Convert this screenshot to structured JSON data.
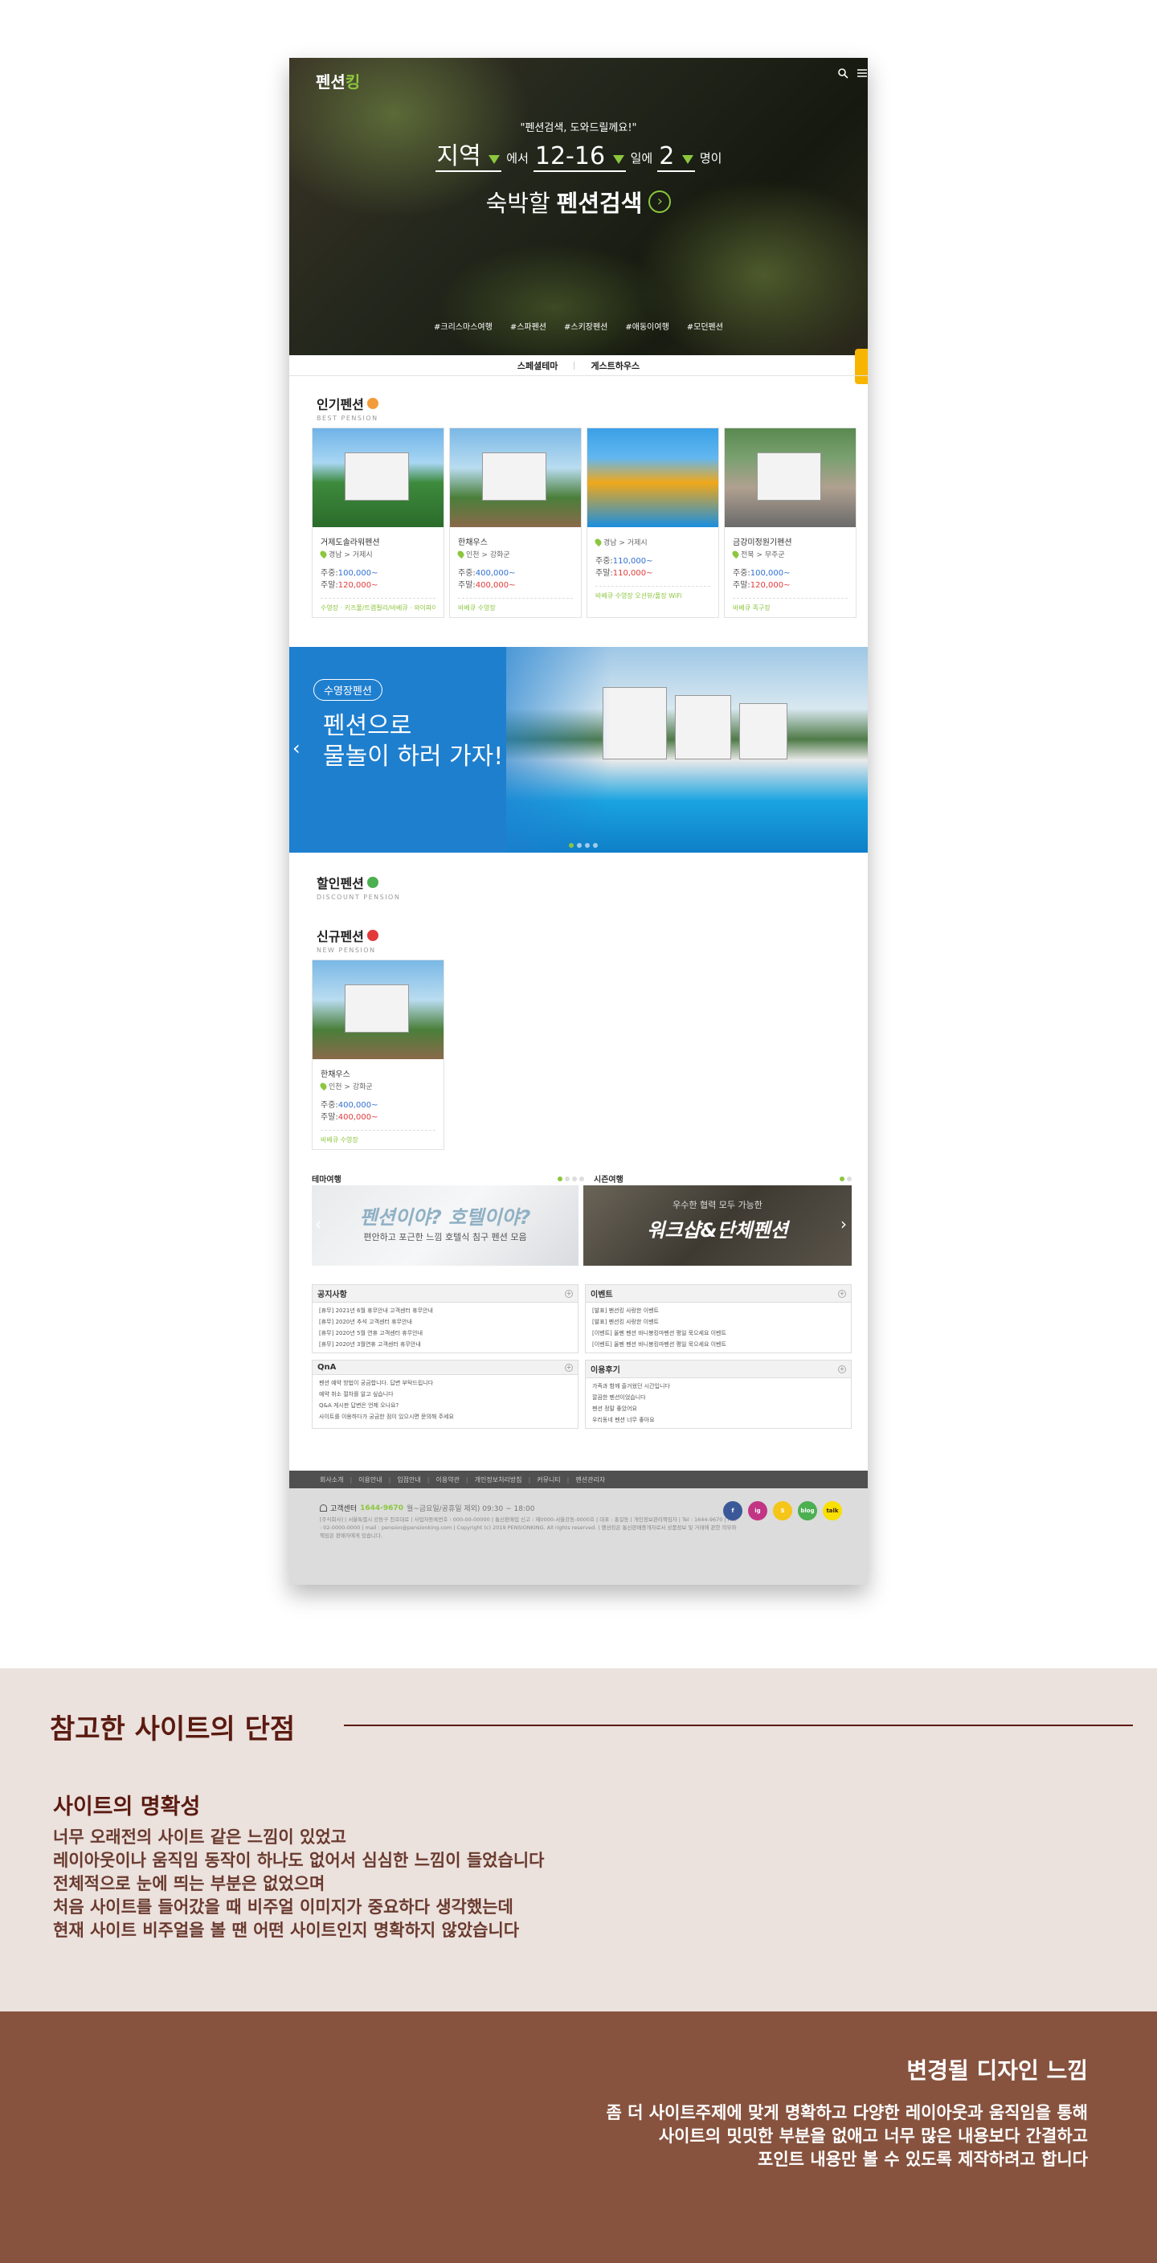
{
  "site": {
    "logo_text": "펜션",
    "logo_accent": "킹",
    "icons": [
      "search-icon",
      "menu-icon"
    ]
  },
  "hero": {
    "tagline": "\"펜션검색, 도와드릴께요!\"",
    "region": "지역",
    "region_suffix": "에서",
    "dates": "12-16",
    "dates_suffix": "일에",
    "count": "2",
    "count_suffix": "명이",
    "line2_pre": "숙박할",
    "line2_bold": "펜션검색",
    "tags": [
      "#크리스마스여행",
      "#스파펜션",
      "#스키장펜션",
      "#애동이여행",
      "#모던펜션"
    ]
  },
  "subnav": [
    "스페셜테마",
    "게스트하우스"
  ],
  "best": {
    "title": "인기펜션",
    "subtitle": "BEST PENSION",
    "items": [
      {
        "name": "거제도솔라워펜션",
        "loc": "경남 > 거제시",
        "weekday": "주중:",
        "weekday_price": "100,000~",
        "weekend": "주말:",
        "weekend_price": "120,000~",
        "footer": "수영장 · 키즈풀/트램펄리/바베큐 · 와이파이"
      },
      {
        "name": "한채우스",
        "loc": "인천 > 강화군",
        "weekday": "주중:",
        "weekday_price": "400,000~",
        "weekend": "주말:",
        "weekend_price": "400,000~",
        "footer": "바베큐 수영장"
      },
      {
        "name": "",
        "loc": "경남 > 거제시",
        "weekday": "주중:",
        "weekday_price": "110,000~",
        "weekend": "주말:",
        "weekend_price": "110,000~",
        "footer": "바베큐 수영장 오션뷰/풀장 WiFi"
      },
      {
        "name": "금강미정원기펜션",
        "loc": "전북 > 무주군",
        "weekday": "주중:",
        "weekday_price": "100,000~",
        "weekend": "주말:",
        "weekend_price": "120,000~",
        "footer": "바베큐 족구장"
      }
    ]
  },
  "banner": {
    "pill": "수영장펜션",
    "headline": "펜션으로\n물놀이 하러 가자!",
    "prev_icon": "chevron-left-icon"
  },
  "discount": {
    "title": "할인펜션",
    "subtitle": "DISCOUNT PENSION"
  },
  "newp": {
    "title": "신규펜션",
    "subtitle": "NEW PENSION",
    "item": {
      "name": "한채우스",
      "loc": "인천 > 강화군",
      "weekday": "주중:",
      "weekday_price": "400,000~",
      "weekend": "주말:",
      "weekend_price": "400,000~",
      "footer": "바베큐 수영장"
    }
  },
  "promos": {
    "left_label": "테마여행",
    "right_label": "시즌여행",
    "left_title": "펜션이야? 호텔이야?",
    "left_sub": "편안하고 포근한 느낌 호텔식 침구 펜션 모음",
    "right_title": "워크샵&단체펜션",
    "right_sub": "우수한 협력 모두 가능한"
  },
  "boards": [
    {
      "title": "공지사항",
      "items": [
        "[휴무] 2021년 6월 휴무안내 고객센터 휴무안내",
        "[휴무] 2020년 추석 고객센터 휴무안내",
        "[휴무] 2020년 5월 연휴 고객센터 휴무안내",
        "[휴무] 2020년 3월연휴 고객센터 휴무안내"
      ]
    },
    {
      "title": "이벤트",
      "items": [
        "[발표] 펜션킹 사랑한 이벤트",
        "[발표] 펜션킹 사랑한 이벤트",
        "[이벤트] 올펜 펜션 바니봉킹마펜션 평일 묵으세요 이벤트",
        "[이벤트] 올펜 펜션 바니봉킹마펜션 평일 묵으세요 이벤트"
      ]
    },
    {
      "title": "QnA",
      "items": [
        "펜션 예약 방법이 궁금합니다. 답변 부탁드립니다",
        "예약 취소 절차를 알고 싶습니다",
        "Q&A 게시판 답변은 언제 오나요?",
        "사이트를 이용하다가 궁금한 점이 있으시면 문의해 주세요"
      ]
    },
    {
      "title": "이용후기",
      "items": [
        "가족과 함께 즐거웠던 시간입니다",
        "깔끔한 펜션이었습니다",
        "펜션 정말 좋았어요",
        "우리동네 펜션 너무 좋아요"
      ]
    }
  ],
  "footer": {
    "nav": [
      "회사소개",
      "이용안내",
      "입점안내",
      "이용약관",
      "개인정보처리방침",
      "커뮤니티",
      "펜션관리자"
    ],
    "cs_label": "고객센터",
    "cs_phone": "1644-9670",
    "cs_hours": "월~금요일/공휴일 제외) 09:30 ~ 18:00",
    "address": "[주식회사] | 서울특별시 강동구 천호대로 | 사업자등록번호 : 000-00-00000 | 통신판매업 신고 : 제0000-서울강동-0000호 | 대표 : 홍길동 | 개인정보관리책임자 | Tel : 1644-9670 | Fax : 02-0000-0000 | mail : pension@pensionking.com | Copyright (c) 2019 PENSIONKING. All rights reserved. | 펜션킹은 통신판매중개자로서 상품정보 및 거래에 관한 의무와 책임은 판매자에게 있습니다.",
    "social": [
      "facebook-icon",
      "instagram-icon",
      "kakaostory-icon",
      "blog-icon",
      "kakaotalk-icon"
    ],
    "social_labels": [
      "f",
      "ig",
      "S",
      "blog",
      "talk"
    ]
  },
  "analysis": {
    "title": "참고한 사이트의 단점",
    "heading": "사이트의 명확성",
    "lines": [
      "너무 오래전의 사이트 같은 느낌이 있었고",
      "레이아웃이나 움직임 동작이 하나도 없어서 심심한 느낌이 들었습니다",
      "전체적으로 눈에 띄는 부분은 없었으며",
      "처음 사이트를 들어갔을 때 비주얼 이미지가 중요하다 생각했는데",
      "현재 사이트 비주얼을 볼 땐 어떤 사이트인지 명확하지 않았습니다"
    ]
  },
  "redesign": {
    "heading": "변경될 디자인 느낌",
    "lines": [
      "좀 더 사이트주제에 맞게 명확하고 다양한 레이아웃과 움직임을 통해",
      "사이트의 밋밋한 부분을 없애고 너무 많은 내용보다 간결하고",
      "포인트 내용만 볼 수 있도록 제작하려고 합니다"
    ]
  },
  "colors": {
    "accent": "#8cc63f",
    "brown": "#5a1a10",
    "banner_blue": "#1f7fcf"
  }
}
